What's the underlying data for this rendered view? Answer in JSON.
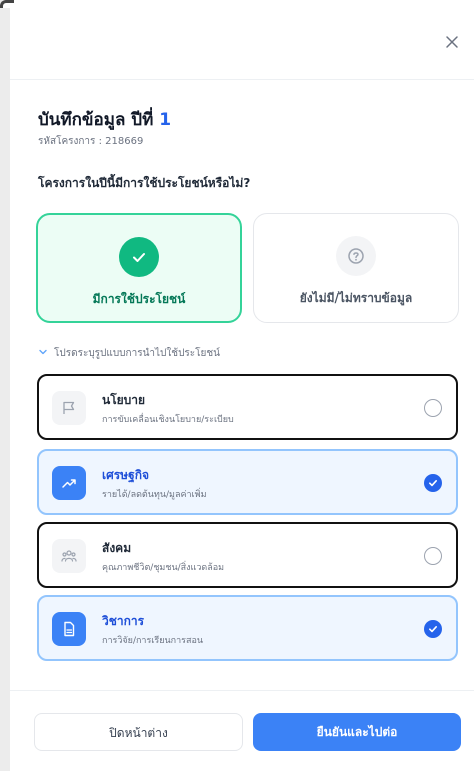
{
  "modal": {
    "title": "บันทึกข้อมูล ปีที่",
    "year": "1",
    "project_code": "รหัสโครงการ : 218669",
    "question": "โครงการในปีนี้มีการใช้ประโยชน์หรือไม่?"
  },
  "choices": [
    {
      "label": "มีการใช้ประโยชน์",
      "selected": true,
      "icon": "check-icon"
    },
    {
      "label": "ยังไม่มี/ไม่ทราบข้อมูล",
      "selected": false,
      "icon": "question-icon"
    }
  ],
  "section": {
    "label": "โปรดระบุรูปแบบการนำไปใช้ประโยชน์",
    "expanded": true
  },
  "options": [
    {
      "title": "นโยบาย",
      "subtitle": "การขับเคลื่อนเชิงนโยบาย/ระเบียบ",
      "checked": false,
      "icon": "flag-icon"
    },
    {
      "title": "เศรษฐกิจ",
      "subtitle": "รายได้/ลดต้นทุน/มูลค่าเพิ่ม",
      "checked": true,
      "icon": "trend-up-icon"
    },
    {
      "title": "สังคม",
      "subtitle": "คุณภาพชีวิต/ชุมชน/สิ่งแวดล้อม",
      "checked": false,
      "icon": "people-icon"
    },
    {
      "title": "วิชาการ",
      "subtitle": "การวิจัย/การเรียนการสอน",
      "checked": true,
      "icon": "document-icon"
    }
  ],
  "footer": {
    "close_label": "ปิดหน้าต่าง",
    "confirm_label": "ยืนยันและไปต่อ"
  },
  "colors": {
    "primary": "#3b82f6",
    "success": "#10b981",
    "selected_bg": "#eff6ff"
  }
}
